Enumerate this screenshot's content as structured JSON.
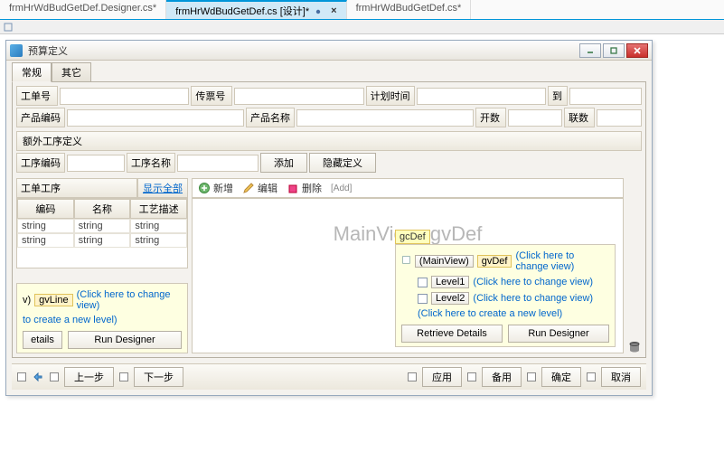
{
  "ide": {
    "tabs": [
      {
        "label": "frmHrWdBudGetDef.Designer.cs*",
        "active": false
      },
      {
        "label": "frmHrWdBudGetDef.cs [设计]*",
        "active": true,
        "close": "×"
      },
      {
        "label": "frmHrWdBudGetDef.cs*",
        "active": false
      }
    ]
  },
  "win": {
    "title": "预算定义",
    "min": "▁",
    "max": "▢",
    "close": "✕"
  },
  "tabs": {
    "general": "常规",
    "other": "其它"
  },
  "fields": {
    "work_order": "工单号",
    "voucher_no": "传票号",
    "plan_time": "计划时间",
    "to": "到",
    "product_code": "产品编码",
    "product_name": "产品名称",
    "open_qty": "开数",
    "copies": "联数"
  },
  "extra_proc": {
    "title": "额外工序定义",
    "code": "工序编码",
    "name": "工序名称",
    "add": "添加",
    "hide": "隐藏定义"
  },
  "left_panel": {
    "title": "工单工序",
    "show_all": "显示全部",
    "columns": {
      "code": "编码",
      "name": "名称",
      "desc": "工艺描述"
    },
    "rows": [
      {
        "code": "string",
        "name": "string",
        "desc": "string"
      },
      {
        "code": "string",
        "name": "string",
        "desc": "string"
      }
    ]
  },
  "left_designer": {
    "view_token_pre": "v)",
    "view_btn": "gvLine",
    "change_view": "(Click here to change view)",
    "create_level": "to create a new level)",
    "details": "etails",
    "run": "Run Designer"
  },
  "cmds": {
    "new": "新增",
    "edit": "编辑",
    "delete": "删除",
    "add_hint": "[Add]"
  },
  "main_view": "MainView: gvDef",
  "gc_panel": {
    "title": "gcDef",
    "main_view": "(MainView)",
    "gvdef": "gvDef",
    "change_view": "(Click here to change view)",
    "level1": "Level1",
    "level2": "Level2",
    "create_level": "(Click here to create a new level)",
    "retrieve": "Retrieve Details",
    "run": "Run Designer"
  },
  "footer": {
    "prev": "上一步",
    "next": "下一步",
    "apply": "应用",
    "backup": "备用",
    "ok": "确定",
    "cancel": "取消"
  }
}
